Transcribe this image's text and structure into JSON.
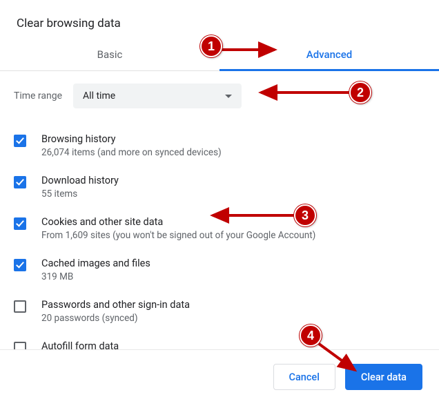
{
  "title": "Clear browsing data",
  "tabs": {
    "basic": "Basic",
    "advanced": "Advanced",
    "active": "advanced"
  },
  "timerange": {
    "label": "Time range",
    "value": "All time"
  },
  "items": [
    {
      "checked": true,
      "title": "Browsing history",
      "sub": "26,074 items (and more on synced devices)"
    },
    {
      "checked": true,
      "title": "Download history",
      "sub": "55 items"
    },
    {
      "checked": true,
      "title": "Cookies and other site data",
      "sub": "From 1,609 sites (you won't be signed out of your Google Account)"
    },
    {
      "checked": true,
      "title": "Cached images and files",
      "sub": "319 MB"
    },
    {
      "checked": false,
      "title": "Passwords and other sign-in data",
      "sub": "20 passwords (synced)"
    },
    {
      "checked": false,
      "title": "Autofill form data",
      "sub": ""
    }
  ],
  "footer": {
    "cancel": "Cancel",
    "clear": "Clear data"
  },
  "annotations": {
    "n1": "1",
    "n2": "2",
    "n3": "3",
    "n4": "4"
  }
}
